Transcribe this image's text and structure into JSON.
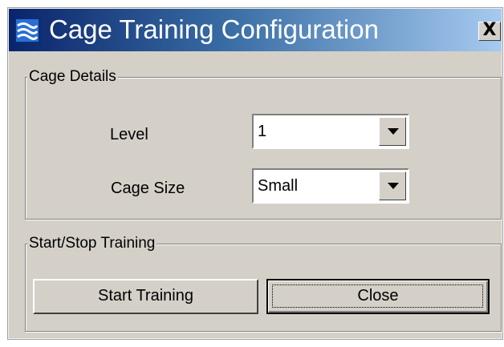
{
  "window": {
    "title": "Cage Training Configuration",
    "close_glyph": "X",
    "title_gradient": [
      "#0a246a",
      "#3a6ea5",
      "#a6caf0"
    ],
    "face_color": "#d4d0c8"
  },
  "cage_details": {
    "legend": "Cage Details",
    "level_label": "Level",
    "level_value": "1",
    "cage_size_label": "Cage Size",
    "cage_size_value": "Small"
  },
  "training": {
    "legend": "Start/Stop Training",
    "start_label": "Start Training",
    "close_label": "Close"
  },
  "icons": {
    "app": "dialog-app-icon",
    "close": "close-icon",
    "dropdown": "chevron-down-icon"
  }
}
